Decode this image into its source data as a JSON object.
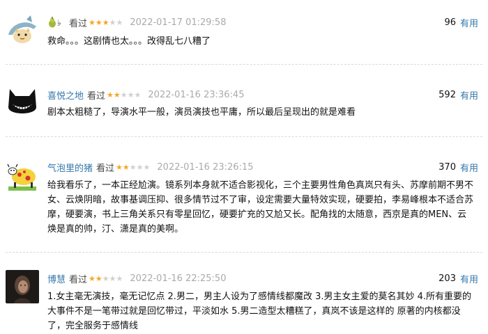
{
  "reviews": [
    {
      "username": "",
      "watched_label": "看过",
      "rating_stars": 3,
      "time": "2022-01-17 01:29:58",
      "votes": "96",
      "useful_label": "有用",
      "content": "救命。。。这剧情也太。。。改得乱七八糟了",
      "avatar_icon": "shark-cat-icon"
    },
    {
      "username": "喜悦之地",
      "watched_label": "看过",
      "rating_stars": 2,
      "time": "2022-01-16 23:36:45",
      "votes": "592",
      "useful_label": "有用",
      "content": "剧本太粗糙了，导演水平一般，演员演技也平庸，所以最后呈现出的就是难看",
      "avatar_icon": "grinning-cat-icon"
    },
    {
      "username": "气泡里的猪",
      "watched_label": "看过",
      "rating_stars": 2,
      "time": "2022-01-16 23:26:15",
      "votes": "370",
      "useful_label": "有用",
      "content": "给我看乐了，一本正经尬演。镜系列本身就不适合影视化，三个主要男性角色真岚只有头、苏摩前期不男不女、云焕阴暗，故事基调压抑、很多情节过不了审，设定需要大量特效实现，硬要拍，李易峰根本不适合苏摩，硬要演，书上三角关系只有零星回忆，硬要扩充的又尬又长。配角找的太随意，西京是真的MEN、云焕是真的帅，汀、潇是真的美啊。",
      "avatar_icon": "cartoon-cow-icon"
    },
    {
      "username": "博慧",
      "watched_label": "看过",
      "rating_stars": 2,
      "time": "2022-01-16 22:25:50",
      "votes": "203",
      "useful_label": "有用",
      "content": "1.女主毫无演技，毫无记忆点 2.男二，男主人设为了感情线都魔改 3.男主女主爱的莫名其妙 4.所有重要的大事件不是一笔带过就是回忆带过，平淡如水 5.男二造型太糟糕了，真岚不该是这样的 原著的内核都没了，完全服务于感情线",
      "avatar_icon": "portrait-photo-icon"
    }
  ],
  "colors": {
    "link": "#3377aa",
    "star": "#f5a623",
    "star_empty": "#d0d0d0",
    "time": "#aaaaaa"
  }
}
